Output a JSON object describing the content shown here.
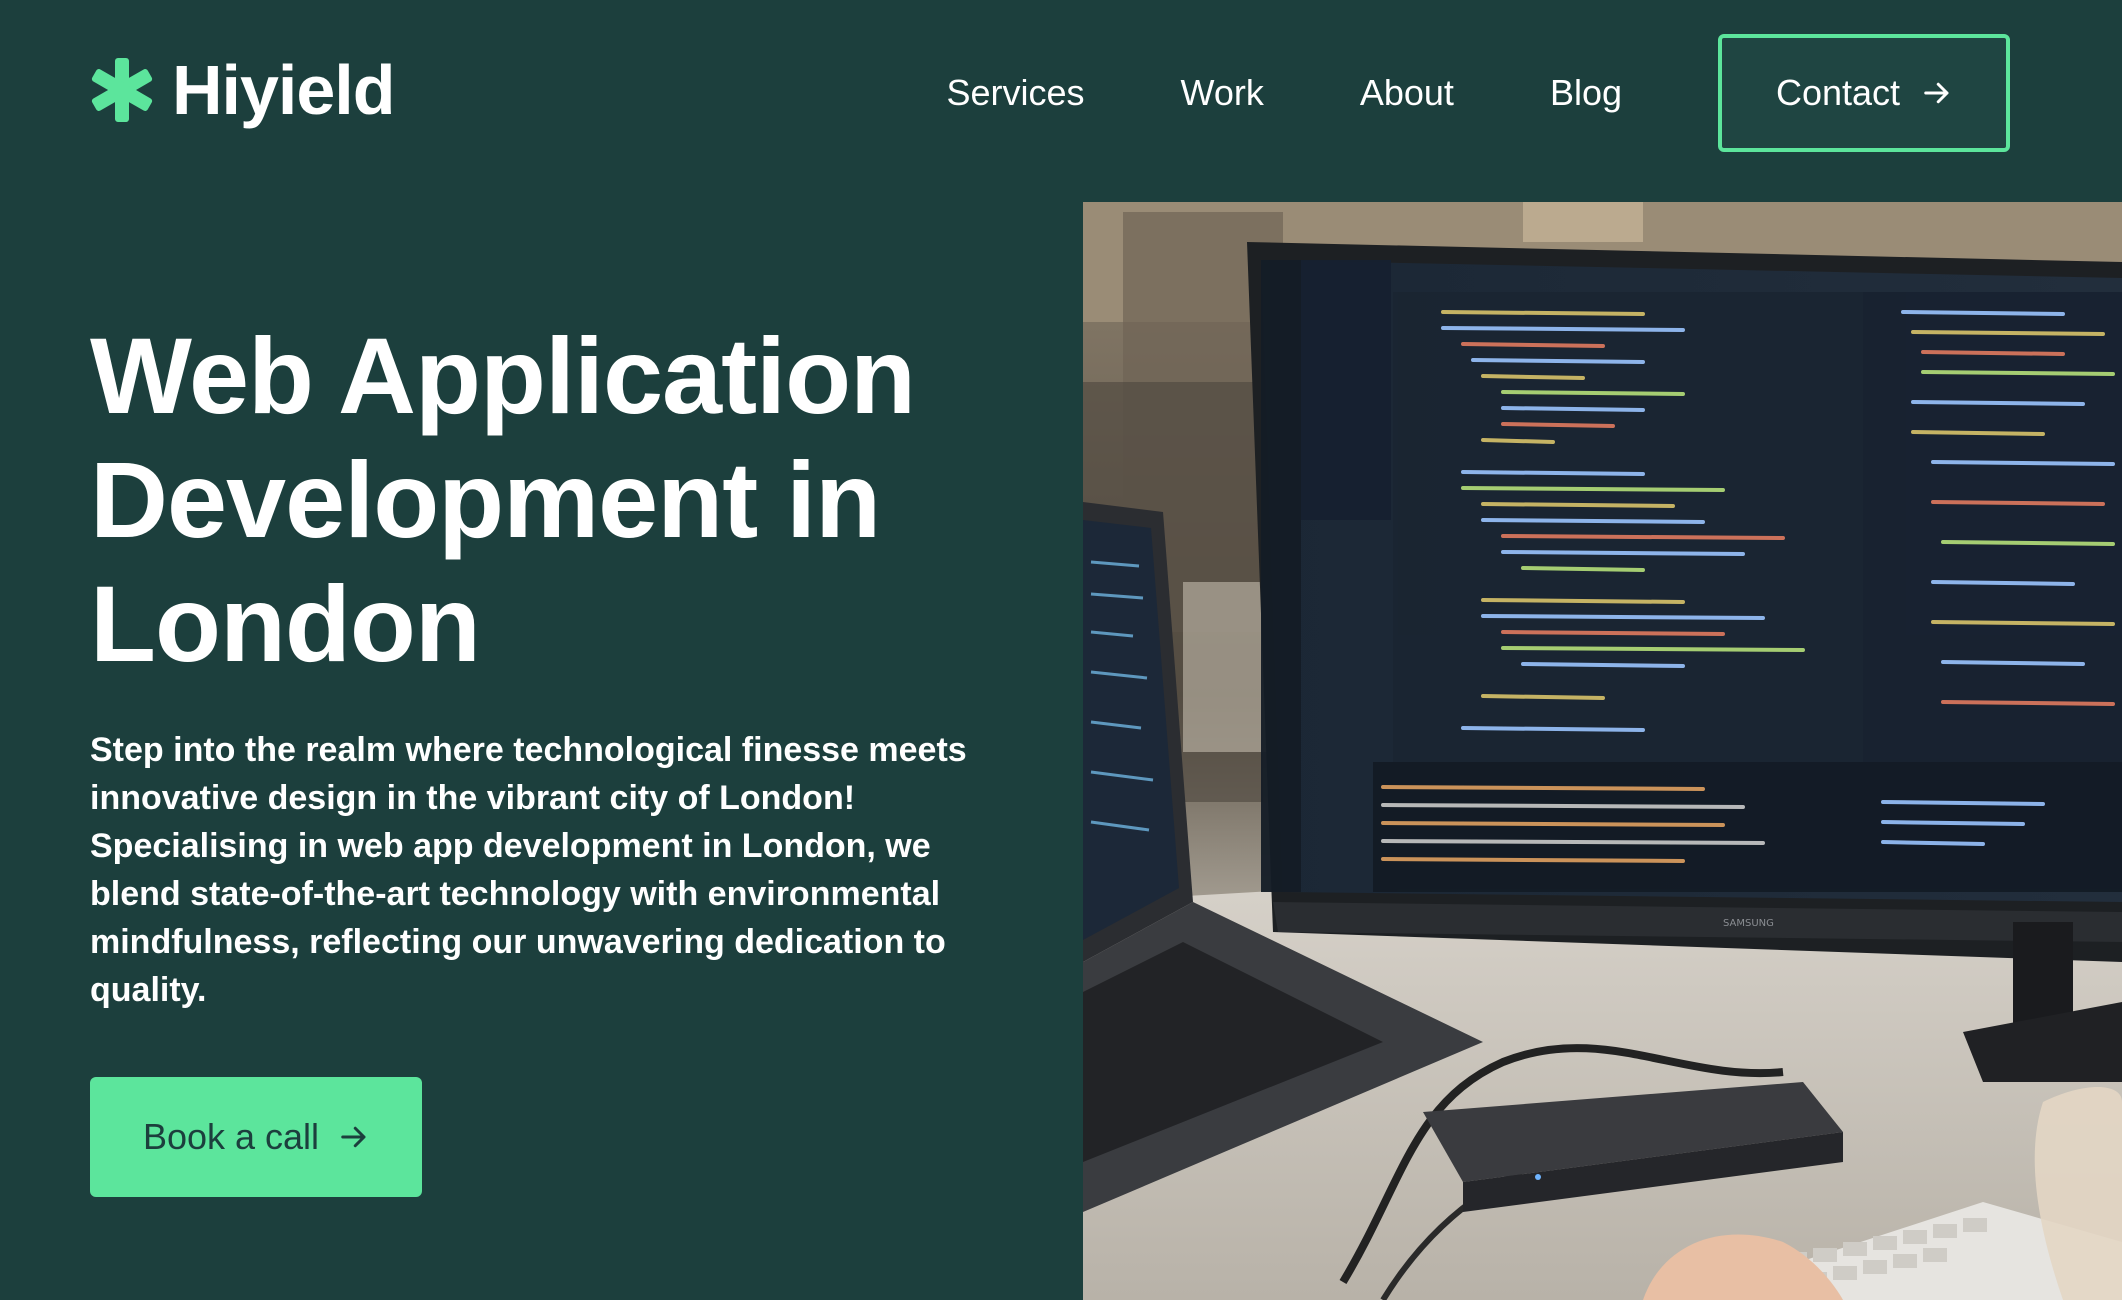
{
  "brand": {
    "name": "Hiyield",
    "accent_color": "#5ce59c",
    "background_color": "#1c3f3d",
    "logo_icon": "asterisk-icon"
  },
  "nav": {
    "items": [
      {
        "label": "Services"
      },
      {
        "label": "Work"
      },
      {
        "label": "About"
      },
      {
        "label": "Blog"
      }
    ],
    "contact_label": "Contact",
    "contact_icon": "arrow-right-icon"
  },
  "hero": {
    "title_lines": [
      "Web Application",
      "Development in",
      "London"
    ],
    "description": "Step into the realm where technological finesse meets innovative design in the vibrant city of London! Specialising in web app development in London, we blend state-of-the-art technology with environmental mindfulness, reflecting our unwavering dedication to quality.",
    "cta_label": "Book a call",
    "cta_icon": "arrow-right-icon",
    "image_subject": "monitor-with-code-photo",
    "monitor_brand": "SAMSUNG"
  }
}
